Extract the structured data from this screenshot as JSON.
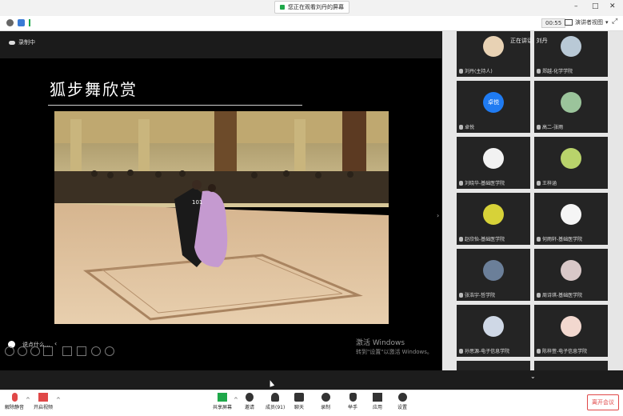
{
  "topbar": {
    "share_status": "您正在观看刘丹的屏幕",
    "minimize": "–",
    "maximize": "□",
    "close": "✕"
  },
  "statusbar": {
    "timer": "00:55",
    "view_label": "演讲者视图"
  },
  "main": {
    "cloud_label": "录制中",
    "slide_title": "狐步舞欣赏",
    "watermark_line1": "激活 Windows",
    "watermark_line2": "转到\"设置\"以激活 Windows。",
    "caption_label": "说点什么..."
  },
  "sidebar": {
    "speaking_label": "正在讲话: 刘丹",
    "tiles": [
      {
        "name": "刘丹(主持人)",
        "color": "#e8d2b4"
      },
      {
        "name": "郑越-化学学院",
        "color": "#b9c9d6"
      },
      {
        "name": "卓悦",
        "color": "#1f7bf2",
        "avatar_text": "卓悦"
      },
      {
        "name": "高二-张雨",
        "color": "#9bc49b"
      },
      {
        "name": "刘晓华-基础医学院",
        "color": "#f2f2f2"
      },
      {
        "name": "王梓涵",
        "color": "#b9d36b"
      },
      {
        "name": "赵欣怡-基础医学院",
        "color": "#d7d238"
      },
      {
        "name": "何雨轩-基础医学院",
        "color": "#f5f5f5"
      },
      {
        "name": "张浩宇-哲学院",
        "color": "#6b7f99"
      },
      {
        "name": "周诗琪-基础医学院",
        "color": "#d9c8c8"
      },
      {
        "name": "孙思源-电子信息学院",
        "color": "#cfd8e6"
      },
      {
        "name": "陈梓萱-电子信息学院",
        "color": "#f2d8cf"
      },
      {
        "name": "",
        "color": "#ececec"
      },
      {
        "name": "",
        "color": "#d7a0a0"
      }
    ]
  },
  "toolbar": {
    "mute": "解除静音",
    "video": "开启视频",
    "share": "共享屏幕",
    "invite": "邀请",
    "members": "成员(91)",
    "chat": "聊天",
    "record": "录制",
    "raise": "举手",
    "apps": "应用",
    "settings": "设置",
    "leave": "离开会议"
  },
  "colors": {
    "accent": "#1fa84a",
    "leave": "#e04848"
  }
}
